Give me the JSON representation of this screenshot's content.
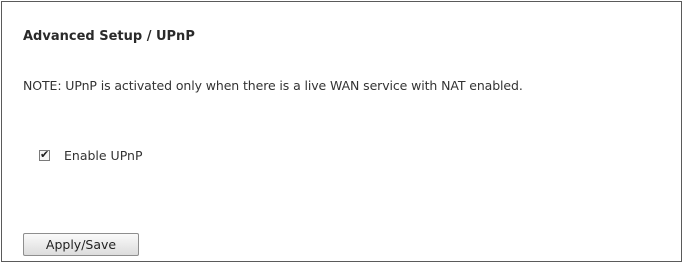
{
  "page": {
    "title": "Advanced Setup / UPnP",
    "note": "NOTE: UPnP is activated only when there is a live WAN service with NAT enabled."
  },
  "form": {
    "enable_upnp": {
      "label": "Enable UPnP",
      "checked": true,
      "check_glyph": "✔"
    },
    "apply_button_label": "Apply/Save"
  },
  "colors": {
    "border": "#5a5a5a",
    "text": "#333333",
    "title": "#2a2a2a"
  }
}
